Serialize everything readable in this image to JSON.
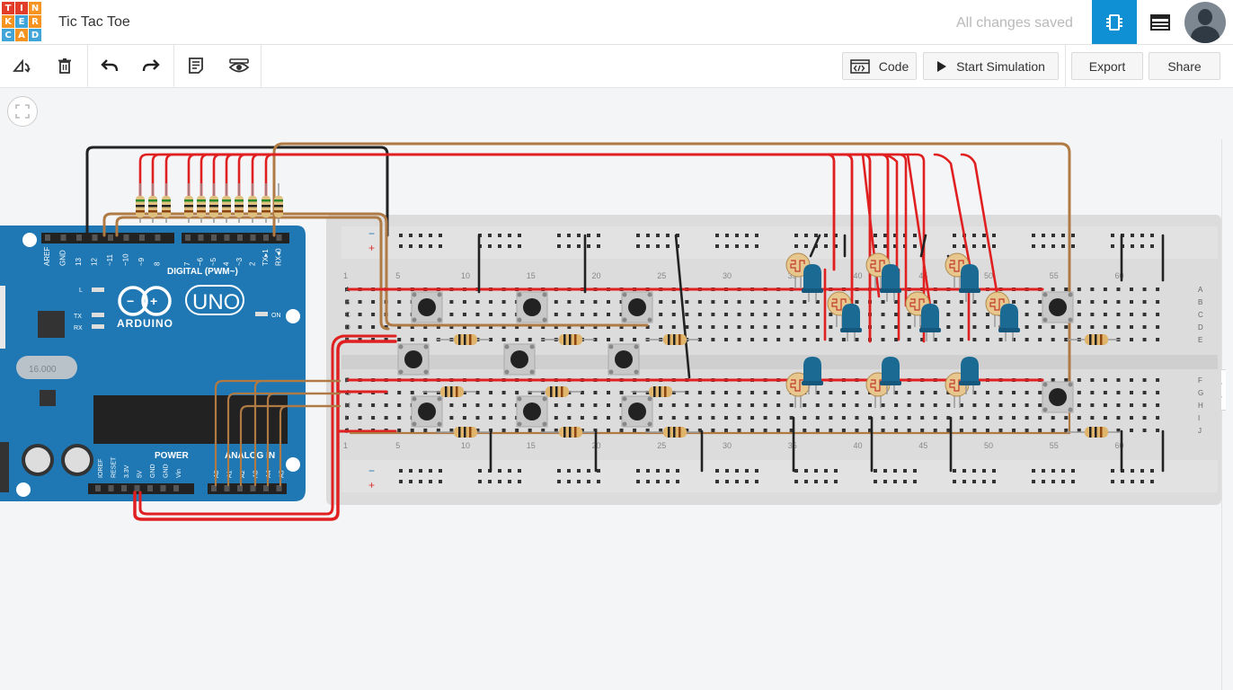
{
  "app": {
    "logo_letters": [
      "T",
      "I",
      "N",
      "K",
      "E",
      "R",
      "C",
      "A",
      "D"
    ],
    "logo_colors": [
      "#e23d28",
      "#e23d28",
      "#f79421",
      "#f79421",
      "#42a5d9",
      "#f79421",
      "#42a5d9",
      "#f79421",
      "#42a5d9"
    ],
    "title": "Tic Tac Toe",
    "status": "All changes saved",
    "accent": "#0f90d5"
  },
  "toolbar": {
    "icons": [
      "rotate-icon",
      "trash-icon",
      "undo-icon",
      "redo-icon",
      "notes-icon",
      "eye-icon"
    ],
    "code_label": "Code",
    "start_label": "Start Simulation",
    "export_label": "Export",
    "share_label": "Share"
  },
  "arduino": {
    "board_name": "ARDUINO",
    "model": "UNO",
    "digital_label": "DIGITAL (PWM~)",
    "power_label": "POWER",
    "analog_label": "ANALOG IN",
    "on_label": "ON",
    "l_label": "L",
    "tx_label": "TX",
    "rx_label": "RX",
    "crystal_label": "16.000",
    "digital_pins": [
      "AREF",
      "GND",
      "13",
      "12",
      "~11",
      "~10",
      "~9",
      "8",
      "7",
      "~6",
      "~5",
      "4",
      "~3",
      "2",
      "TX▸1",
      "RX◂0"
    ],
    "power_pins": [
      "IOREF",
      "RESET",
      "3.3V",
      "5V",
      "GND",
      "GND",
      "Vin"
    ],
    "analog_pins": [
      "A0",
      "A1",
      "A2",
      "A3",
      "A4",
      "A5"
    ]
  },
  "breadboard": {
    "col_labels": [
      "1",
      "5",
      "10",
      "15",
      "20",
      "25",
      "30",
      "35",
      "40",
      "45",
      "50",
      "55",
      "60"
    ],
    "row_labels_top": [
      "A",
      "B",
      "C",
      "D",
      "E"
    ],
    "row_labels_bottom": [
      "F",
      "G",
      "H",
      "I",
      "J"
    ],
    "rail_minus": "−",
    "rail_plus": "+"
  },
  "colors": {
    "wire_red": "#e02020",
    "wire_brown": "#b07a45",
    "wire_black": "#222222",
    "board_blue": "#1f78b4",
    "led_blue": "#1a6a94"
  }
}
